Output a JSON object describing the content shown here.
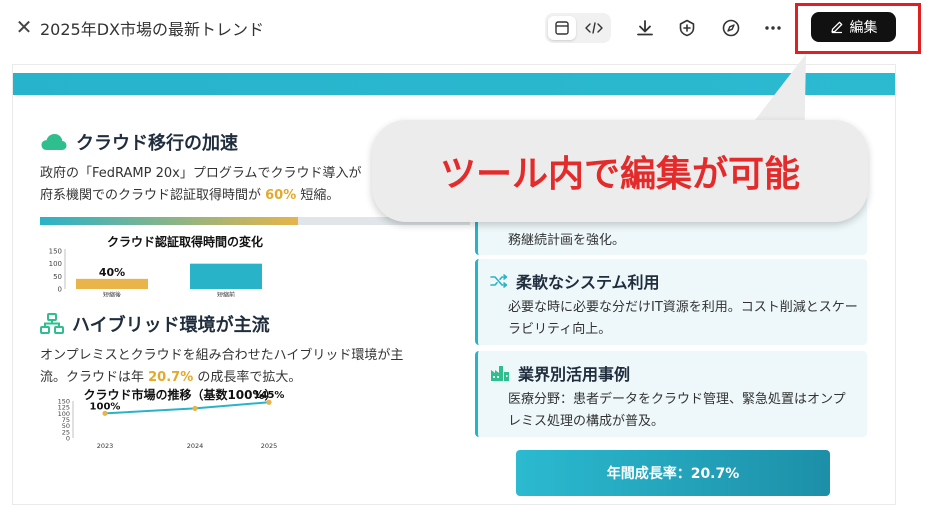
{
  "header": {
    "close_glyph": "✕",
    "title": "2025年DX市場の最新トレンド",
    "edit_label": "編集",
    "icons": [
      "preview-icon",
      "code-icon",
      "download-icon",
      "share-icon",
      "compass-icon",
      "more-icon",
      "pencil-icon"
    ]
  },
  "sections": {
    "cloud": {
      "title": "クラウド移行の加速",
      "text_pre": "政府の「FedRAMP 20x」プログラムでクラウド導入が",
      "text_line2_pre": "府系機関でのクラウド認証取得時間が ",
      "text_highlight": "60%",
      "text_post": " 短縮。",
      "progress_fraction": 0.6
    },
    "hybrid": {
      "title": "ハイブリッド環境が主流",
      "text_line1": "オンプレミスとクラウドを組み合わせたハイブリッド環境が主",
      "text_line2_pre": "流。クラウドは年 ",
      "text_highlight": "20.7%",
      "text_post": " の成長率で拡大。"
    }
  },
  "cards": {
    "bcp_body": "務継続計画を強化。",
    "flex": {
      "title": "柔軟なシステム利用",
      "body": "必要な時に必要な分だけIT資源を利用。コスト削減とスケーラビリティ向上。"
    },
    "industry": {
      "title": "業界別活用事例",
      "body": "医療分野：患者データをクラウド管理、緊急処置はオンプレミス処理の構成が普及。"
    }
  },
  "growth_label": "年間成長率：20.7%",
  "callout": {
    "text": "ツール内で編集が可能"
  },
  "colors": {
    "accent": "#29b3c9",
    "highlight": "#e3a92a",
    "callout_text": "#e42b2b",
    "edit_frame": "#e02020"
  },
  "chart_data": [
    {
      "type": "bar",
      "title": "クラウド認証取得時間の変化",
      "categories": [
        "短縮後",
        "短縮前"
      ],
      "values": [
        40,
        100
      ],
      "data_labels": [
        "40%",
        ""
      ],
      "yticks": [
        0,
        50,
        100,
        150
      ],
      "ylim": [
        0,
        150
      ],
      "colors": [
        "#e9b449",
        "#29b3c9"
      ]
    },
    {
      "type": "line",
      "title": "クラウド市場の推移（基数100%）",
      "categories": [
        "2023",
        "2024",
        "2025"
      ],
      "series": [
        {
          "values": [
            100,
            120,
            145
          ]
        }
      ],
      "data_labels": [
        "100%",
        "",
        "145%"
      ],
      "yticks": [
        0,
        25,
        50,
        75,
        100,
        125,
        150
      ],
      "ylim": [
        0,
        150
      ]
    }
  ]
}
